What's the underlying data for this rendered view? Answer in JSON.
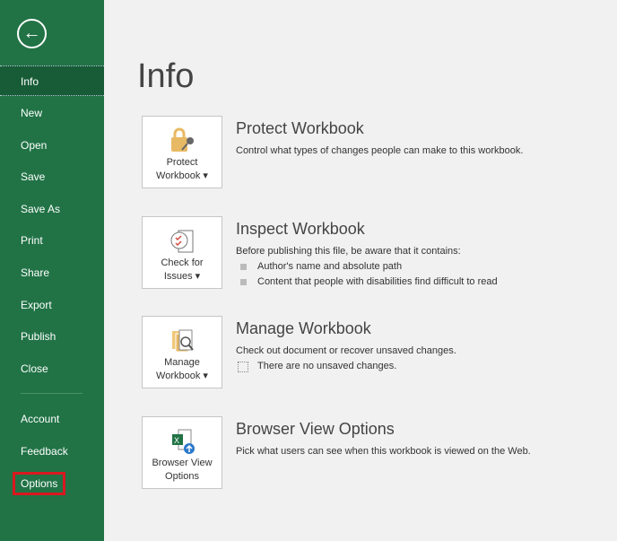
{
  "sidebar": {
    "back_label": "←",
    "items": [
      "Info",
      "New",
      "Open",
      "Save",
      "Save As",
      "Print",
      "Share",
      "Export",
      "Publish",
      "Close"
    ],
    "bottom_items": [
      "Account",
      "Feedback",
      "Options"
    ]
  },
  "page_title": "Info",
  "sections": [
    {
      "button": [
        "Protect",
        "Workbook ▾"
      ],
      "title": "Protect Workbook",
      "desc": "Control what types of changes people can make to this workbook."
    },
    {
      "button": [
        "Check for",
        "Issues ▾"
      ],
      "title": "Inspect Workbook",
      "desc": "Before publishing this file, be aware that it contains:",
      "bullets": [
        "Author's name and absolute path",
        "Content that people with disabilities find difficult to read"
      ]
    },
    {
      "button": [
        "Manage",
        "Workbook ▾"
      ],
      "title": "Manage Workbook",
      "desc": "Check out document or recover unsaved changes.",
      "note": "There are no unsaved changes."
    },
    {
      "button": [
        "Browser View",
        "Options"
      ],
      "title": "Browser View Options",
      "desc": "Pick what users can see when this workbook is viewed on the Web."
    }
  ]
}
